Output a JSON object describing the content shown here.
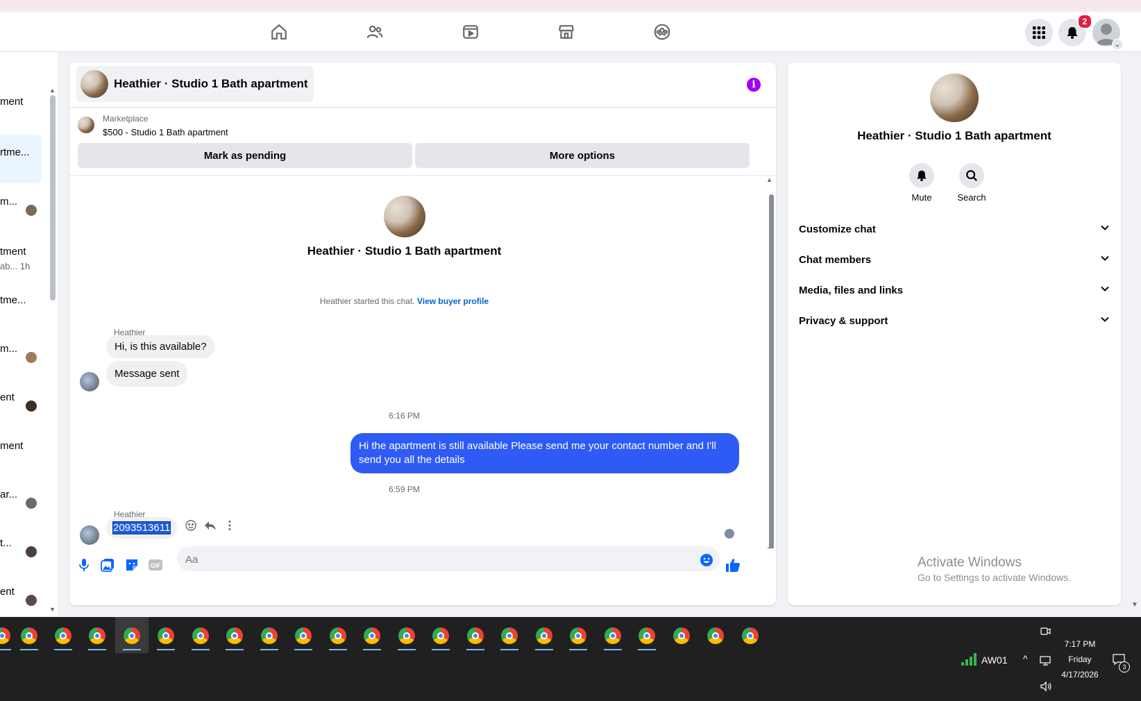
{
  "topnav": {
    "icons": [
      "home-icon",
      "friends-icon",
      "video-icon",
      "marketplace-icon",
      "groups-icon"
    ],
    "menu_icon": "grid-menu-icon",
    "notification_count": "2"
  },
  "left_list": {
    "items": [
      {
        "text": "ment"
      },
      {
        "text": "rtme..."
      },
      {
        "text": "m..."
      },
      {
        "text": "tment",
        "sub": "ab... 1h"
      },
      {
        "text": "tme..."
      },
      {
        "text": "m..."
      },
      {
        "text": "ent"
      },
      {
        "text": "ment"
      },
      {
        "text": "ar..."
      },
      {
        "text": "t..."
      },
      {
        "text": "ent"
      }
    ]
  },
  "chat": {
    "title": "Heathier · Studio 1 Bath apartment",
    "marketplace_label": "Marketplace",
    "listing": "$500 - Studio 1 Bath apartment",
    "mark_pending": "Mark as pending",
    "more_options": "More options",
    "center_name": "Heathier · Studio 1 Bath apartment",
    "started_text": "Heathier started this chat.",
    "view_buyer": "View buyer profile",
    "messages": {
      "sender1": "Heathier",
      "msg1": "Hi, is this available?",
      "msg2": "Message sent",
      "time1": "6:16 PM",
      "out1": "Hi the apartment is still available Please send me your contact number and I'll send you all the details",
      "time2": "6:59 PM",
      "sender2": "Heathier",
      "msg3": "2093513611"
    },
    "composer_placeholder": "Aa"
  },
  "right_panel": {
    "title": "Heathier · Studio 1 Bath apartment",
    "mute": "Mute",
    "search": "Search",
    "rows": [
      "Customize chat",
      "Chat members",
      "Media, files and links",
      "Privacy & support"
    ]
  },
  "watermark": {
    "line1": "Activate Windows",
    "line2": "Go to Settings to activate Windows."
  },
  "taskbar": {
    "network": "AW01",
    "time": "7:17 PM",
    "day": "Friday",
    "date": "4/17/2026",
    "notification_count": "3"
  },
  "colors": {
    "accent": "#0866ff",
    "outgoing_bubble": "#2e5bf5",
    "info_purple": "#a100f2"
  }
}
